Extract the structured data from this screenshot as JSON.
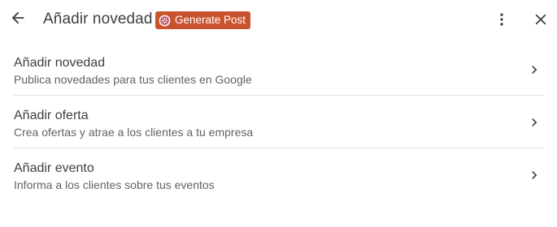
{
  "header": {
    "title": "Añadir novedad",
    "generate_label": "Generate Post",
    "icons": [
      "arrow-back-icon",
      "brand-logo-icon",
      "more-vert-icon",
      "close-icon"
    ],
    "accent": "#c8532e"
  },
  "items": [
    {
      "title": "Añadir novedad",
      "subtitle": "Publica novedades para tus clientes en Google"
    },
    {
      "title": "Añadir oferta",
      "subtitle": "Crea ofertas y atrae a los clientes a tu empresa"
    },
    {
      "title": "Añadir evento",
      "subtitle": "Informa a los clientes sobre tus eventos"
    }
  ]
}
